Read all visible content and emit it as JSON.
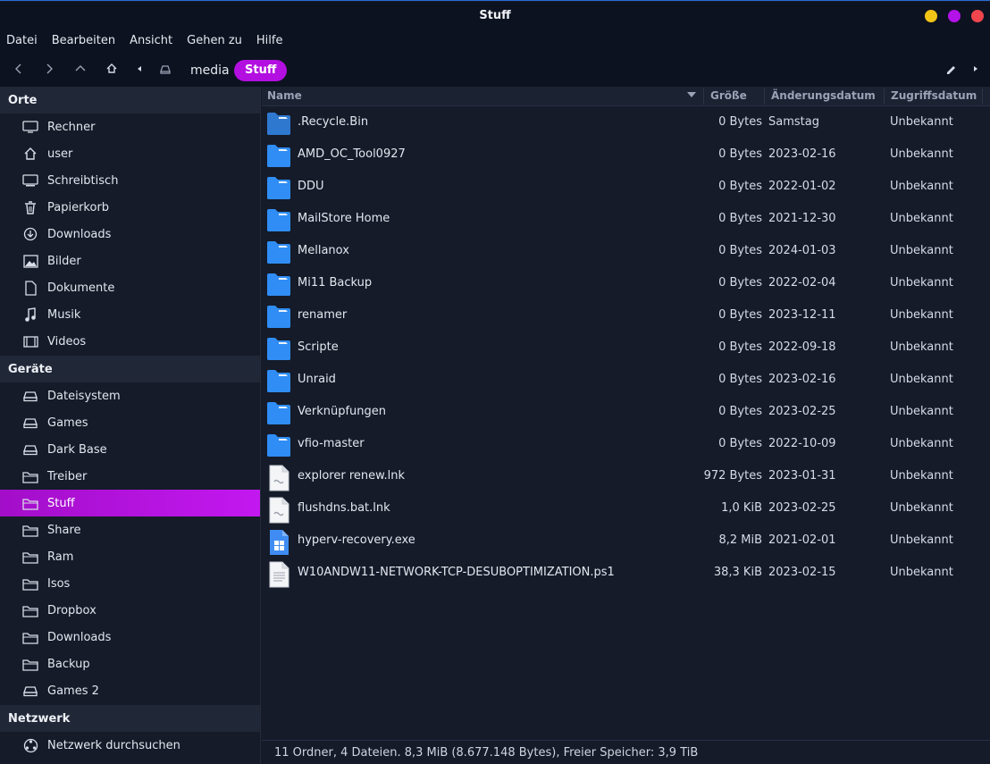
{
  "window": {
    "title": "Stuff"
  },
  "menu": [
    "Datei",
    "Bearbeiten",
    "Ansicht",
    "Gehen zu",
    "Hilfe"
  ],
  "breadcrumb": {
    "parent": "media",
    "current": "Stuff"
  },
  "sidebar": {
    "places_heading": "Orte",
    "places": [
      {
        "label": "Rechner",
        "icon": "computer-icon"
      },
      {
        "label": "user",
        "icon": "home-icon"
      },
      {
        "label": "Schreibtisch",
        "icon": "desktop-icon"
      },
      {
        "label": "Papierkorb",
        "icon": "trash-icon"
      },
      {
        "label": "Downloads",
        "icon": "download-icon"
      },
      {
        "label": "Bilder",
        "icon": "image-icon"
      },
      {
        "label": "Dokumente",
        "icon": "document-icon"
      },
      {
        "label": "Musik",
        "icon": "music-icon"
      },
      {
        "label": "Videos",
        "icon": "video-icon"
      }
    ],
    "devices_heading": "Geräte",
    "devices": [
      {
        "label": "Dateisystem",
        "icon": "drive-icon"
      },
      {
        "label": "Games",
        "icon": "drive-icon"
      },
      {
        "label": "Dark Base",
        "icon": "drive-icon"
      },
      {
        "label": "Treiber",
        "icon": "folder-icon"
      },
      {
        "label": "Stuff",
        "icon": "folder-icon",
        "active": true
      },
      {
        "label": "Share",
        "icon": "folder-icon"
      },
      {
        "label": "Ram",
        "icon": "folder-icon"
      },
      {
        "label": "Isos",
        "icon": "folder-icon"
      },
      {
        "label": "Dropbox",
        "icon": "folder-icon"
      },
      {
        "label": "Downloads",
        "icon": "folder-icon"
      },
      {
        "label": "Backup",
        "icon": "folder-icon"
      },
      {
        "label": "Games 2",
        "icon": "drive-icon"
      }
    ],
    "network_heading": "Netzwerk",
    "network": [
      {
        "label": "Netzwerk durchsuchen",
        "icon": "network-icon"
      }
    ]
  },
  "columns": {
    "name": "Name",
    "size": "Größe",
    "modified": "Änderungsdatum",
    "accessed": "Zugriffsdatum"
  },
  "files": [
    {
      "name": ".Recycle.Bin",
      "size": "0 Bytes",
      "date": "Samstag",
      "access": "Unbekannt",
      "type": "folder-dark"
    },
    {
      "name": "AMD_OC_Tool0927",
      "size": "0 Bytes",
      "date": "2023-02-16",
      "access": "Unbekannt",
      "type": "folder"
    },
    {
      "name": "DDU",
      "size": "0 Bytes",
      "date": "2022-01-02",
      "access": "Unbekannt",
      "type": "folder"
    },
    {
      "name": "MailStore Home",
      "size": "0 Bytes",
      "date": "2021-12-30",
      "access": "Unbekannt",
      "type": "folder"
    },
    {
      "name": "Mellanox",
      "size": "0 Bytes",
      "date": "2024-01-03",
      "access": "Unbekannt",
      "type": "folder"
    },
    {
      "name": "Mi11 Backup",
      "size": "0 Bytes",
      "date": "2022-02-04",
      "access": "Unbekannt",
      "type": "folder"
    },
    {
      "name": "renamer",
      "size": "0 Bytes",
      "date": "2023-12-11",
      "access": "Unbekannt",
      "type": "folder"
    },
    {
      "name": "Scripte",
      "size": "0 Bytes",
      "date": "2022-09-18",
      "access": "Unbekannt",
      "type": "folder"
    },
    {
      "name": "Unraid",
      "size": "0 Bytes",
      "date": "2023-02-16",
      "access": "Unbekannt",
      "type": "folder"
    },
    {
      "name": "Verknüpfungen",
      "size": "0 Bytes",
      "date": "2023-02-25",
      "access": "Unbekannt",
      "type": "folder"
    },
    {
      "name": "vfio-master",
      "size": "0 Bytes",
      "date": "2022-10-09",
      "access": "Unbekannt",
      "type": "folder"
    },
    {
      "name": "explorer renew.lnk",
      "size": "972 Bytes",
      "date": "2023-01-31",
      "access": "Unbekannt",
      "type": "link"
    },
    {
      "name": "flushdns.bat.lnk",
      "size": "1,0 KiB",
      "date": "2023-02-25",
      "access": "Unbekannt",
      "type": "link"
    },
    {
      "name": "hyperv-recovery.exe",
      "size": "8,2 MiB",
      "date": "2021-02-01",
      "access": "Unbekannt",
      "type": "exe"
    },
    {
      "name": "W10ANDW11-NETWORK-TCP-DESUBOPTIMIZATION.ps1",
      "size": "38,3 KiB",
      "date": "2023-02-15",
      "access": "Unbekannt",
      "type": "text"
    }
  ],
  "status": "11 Ordner, 4 Dateien. 8,3 MiB (8.677.148 Bytes), Freier Speicher: 3,9 TiB",
  "colors": {
    "accent": "#b20fe0",
    "folder": "#2f8df5",
    "background": "#151b29"
  }
}
